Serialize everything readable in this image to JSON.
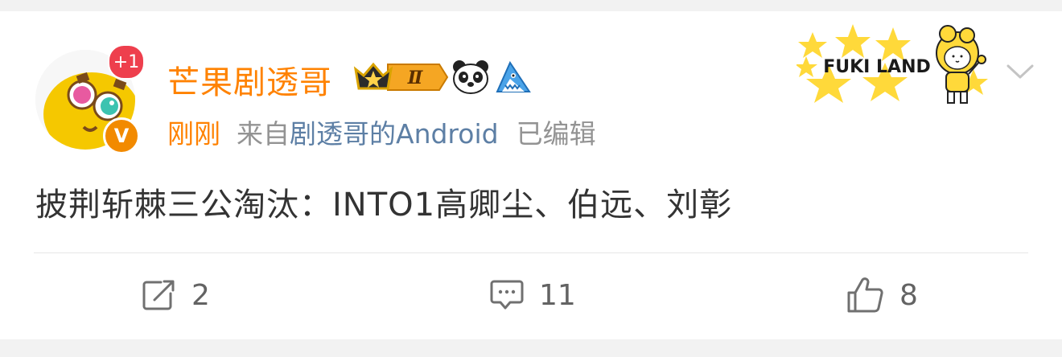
{
  "post": {
    "author_name": "芒果剧透哥",
    "follow_badge": "+1",
    "verified_badge": "V",
    "level_badge": "Ⅱ",
    "time": "刚刚",
    "source_prefix": "来自",
    "source_device": "剧透哥的Android",
    "edited_label": "已编辑",
    "sticker_text": "FUKI LAND",
    "content": "披荆斩棘三公淘汰：INTO1高卿尘、伯远、刘彰"
  },
  "actions": {
    "repost_count": "2",
    "comment_count": "11",
    "like_count": "8"
  },
  "colors": {
    "name": "#ff8200",
    "link": "#5d7fa5",
    "meta_gray": "#939393",
    "text": "#333333"
  }
}
